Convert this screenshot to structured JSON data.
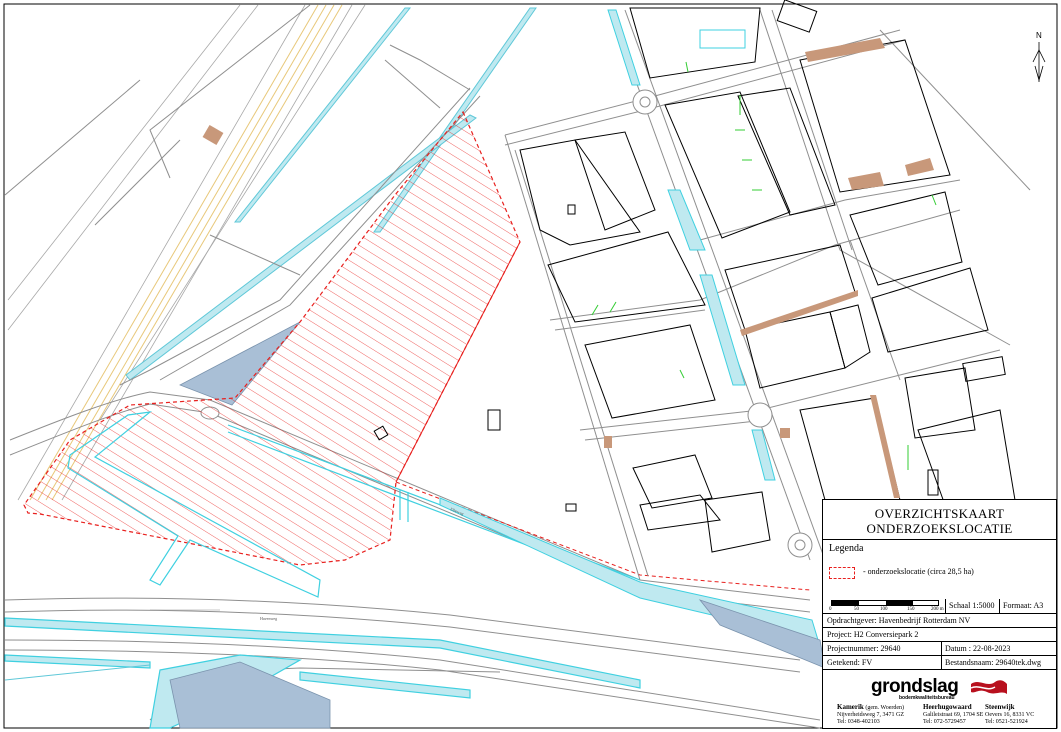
{
  "map": {
    "north_label": "N",
    "colors": {
      "study_area": "#e8201e",
      "water": "#9fd8e4",
      "water_blue": "#a9bfd6",
      "rail": "#e8c87a",
      "roads": "#8f8f8f",
      "buildings": "#000000",
      "green_marks": "#33cc33",
      "paving": "#c8987a"
    },
    "road_labels": [
      "Elbeweg",
      "Havenweg"
    ]
  },
  "title_block": {
    "title_line1": "OVERZICHTSKAART",
    "title_line2": "ONDERZOEKSLOCATIE",
    "legend_heading": "Legenda",
    "legend_item": "- onderzoekslocatie (circa 28,5 ha)",
    "scale_ticks": [
      "0",
      "50",
      "100",
      "150",
      "200 m"
    ],
    "scale": "Schaal 1:5000",
    "format": "Formaat: A3",
    "client": "Opdrachtgever: Havenbedrijf Rotterdam NV",
    "project": "Project: H2 Conversiepark 2",
    "project_number": "Projectnummer:  29640",
    "date": "Datum :  22-08-2023",
    "drawn_by": "Getekend: FV",
    "file_name": "Bestandsnaam: 29640tek.dwg",
    "logo": "grondslag",
    "logo_sub": "bodemkwaliteitsbureau",
    "offices": [
      {
        "name": "Kamerik",
        "extra": "(gem. Woerden)",
        "address": "Nijverheidsweg 7, 3471 GZ",
        "phone": "Tel: 0348-402103"
      },
      {
        "name": "Heerhugowaard",
        "extra": "",
        "address": "Galileistraat 69, 1704 SE",
        "phone": "Tel: 072-5729457"
      },
      {
        "name": "Steenwijk",
        "extra": "",
        "address": "Oevers 16, 8331 VC",
        "phone": "Tel: 0521-521924"
      }
    ]
  }
}
